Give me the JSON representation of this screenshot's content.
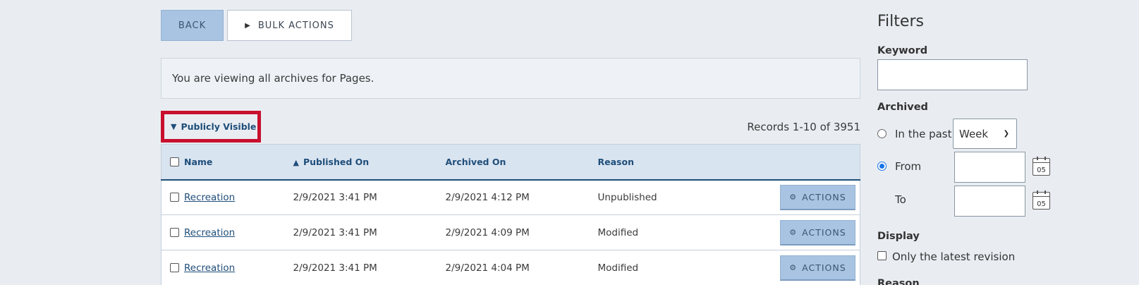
{
  "toolbar": {
    "back_label": "BACK",
    "bulk_actions_label": "BULK ACTIONS",
    "bulk_actions_icon": "play-triangle-icon"
  },
  "info_message": "You are viewing all archives for Pages.",
  "visibility_toggle": {
    "label": "Publicly Visible",
    "icon": "caret-down-icon"
  },
  "records_text": "Records 1-10 of 3951",
  "table": {
    "headers": {
      "name": "Name",
      "published_on": "Published On",
      "archived_on": "Archived On",
      "reason": "Reason"
    },
    "sort": {
      "column": "published_on",
      "direction": "ascending",
      "icon": "sort-up-triangle-icon"
    },
    "rows": [
      {
        "name": "Recreation",
        "published_on": "2/9/2021 3:41 PM",
        "archived_on": "2/9/2021 4:12 PM",
        "reason": "Unpublished",
        "action_label": "ACTIONS"
      },
      {
        "name": "Recreation",
        "published_on": "2/9/2021 3:41 PM",
        "archived_on": "2/9/2021 4:09 PM",
        "reason": "Modified",
        "action_label": "ACTIONS"
      },
      {
        "name": "Recreation",
        "published_on": "2/9/2021 3:41 PM",
        "archived_on": "2/9/2021 4:04 PM",
        "reason": "Modified",
        "action_label": "ACTIONS"
      }
    ]
  },
  "filters": {
    "title": "Filters",
    "keyword_label": "Keyword",
    "keyword_value": "",
    "archived_label": "Archived",
    "in_the_past_label": "In the past",
    "period_selected": "Week",
    "from_label": "From",
    "from_value": "",
    "to_label": "To",
    "to_value": "",
    "calendar_day": "05",
    "display_label": "Display",
    "latest_revision_label": "Only the latest revision",
    "reason_label": "Reason"
  },
  "colors": {
    "page_bg": "#e9edf2",
    "primary_button": "#a8c4e2",
    "header_text": "#1f4e79",
    "highlight_border": "#c8102e",
    "radio_selected": "#1a73e8"
  }
}
